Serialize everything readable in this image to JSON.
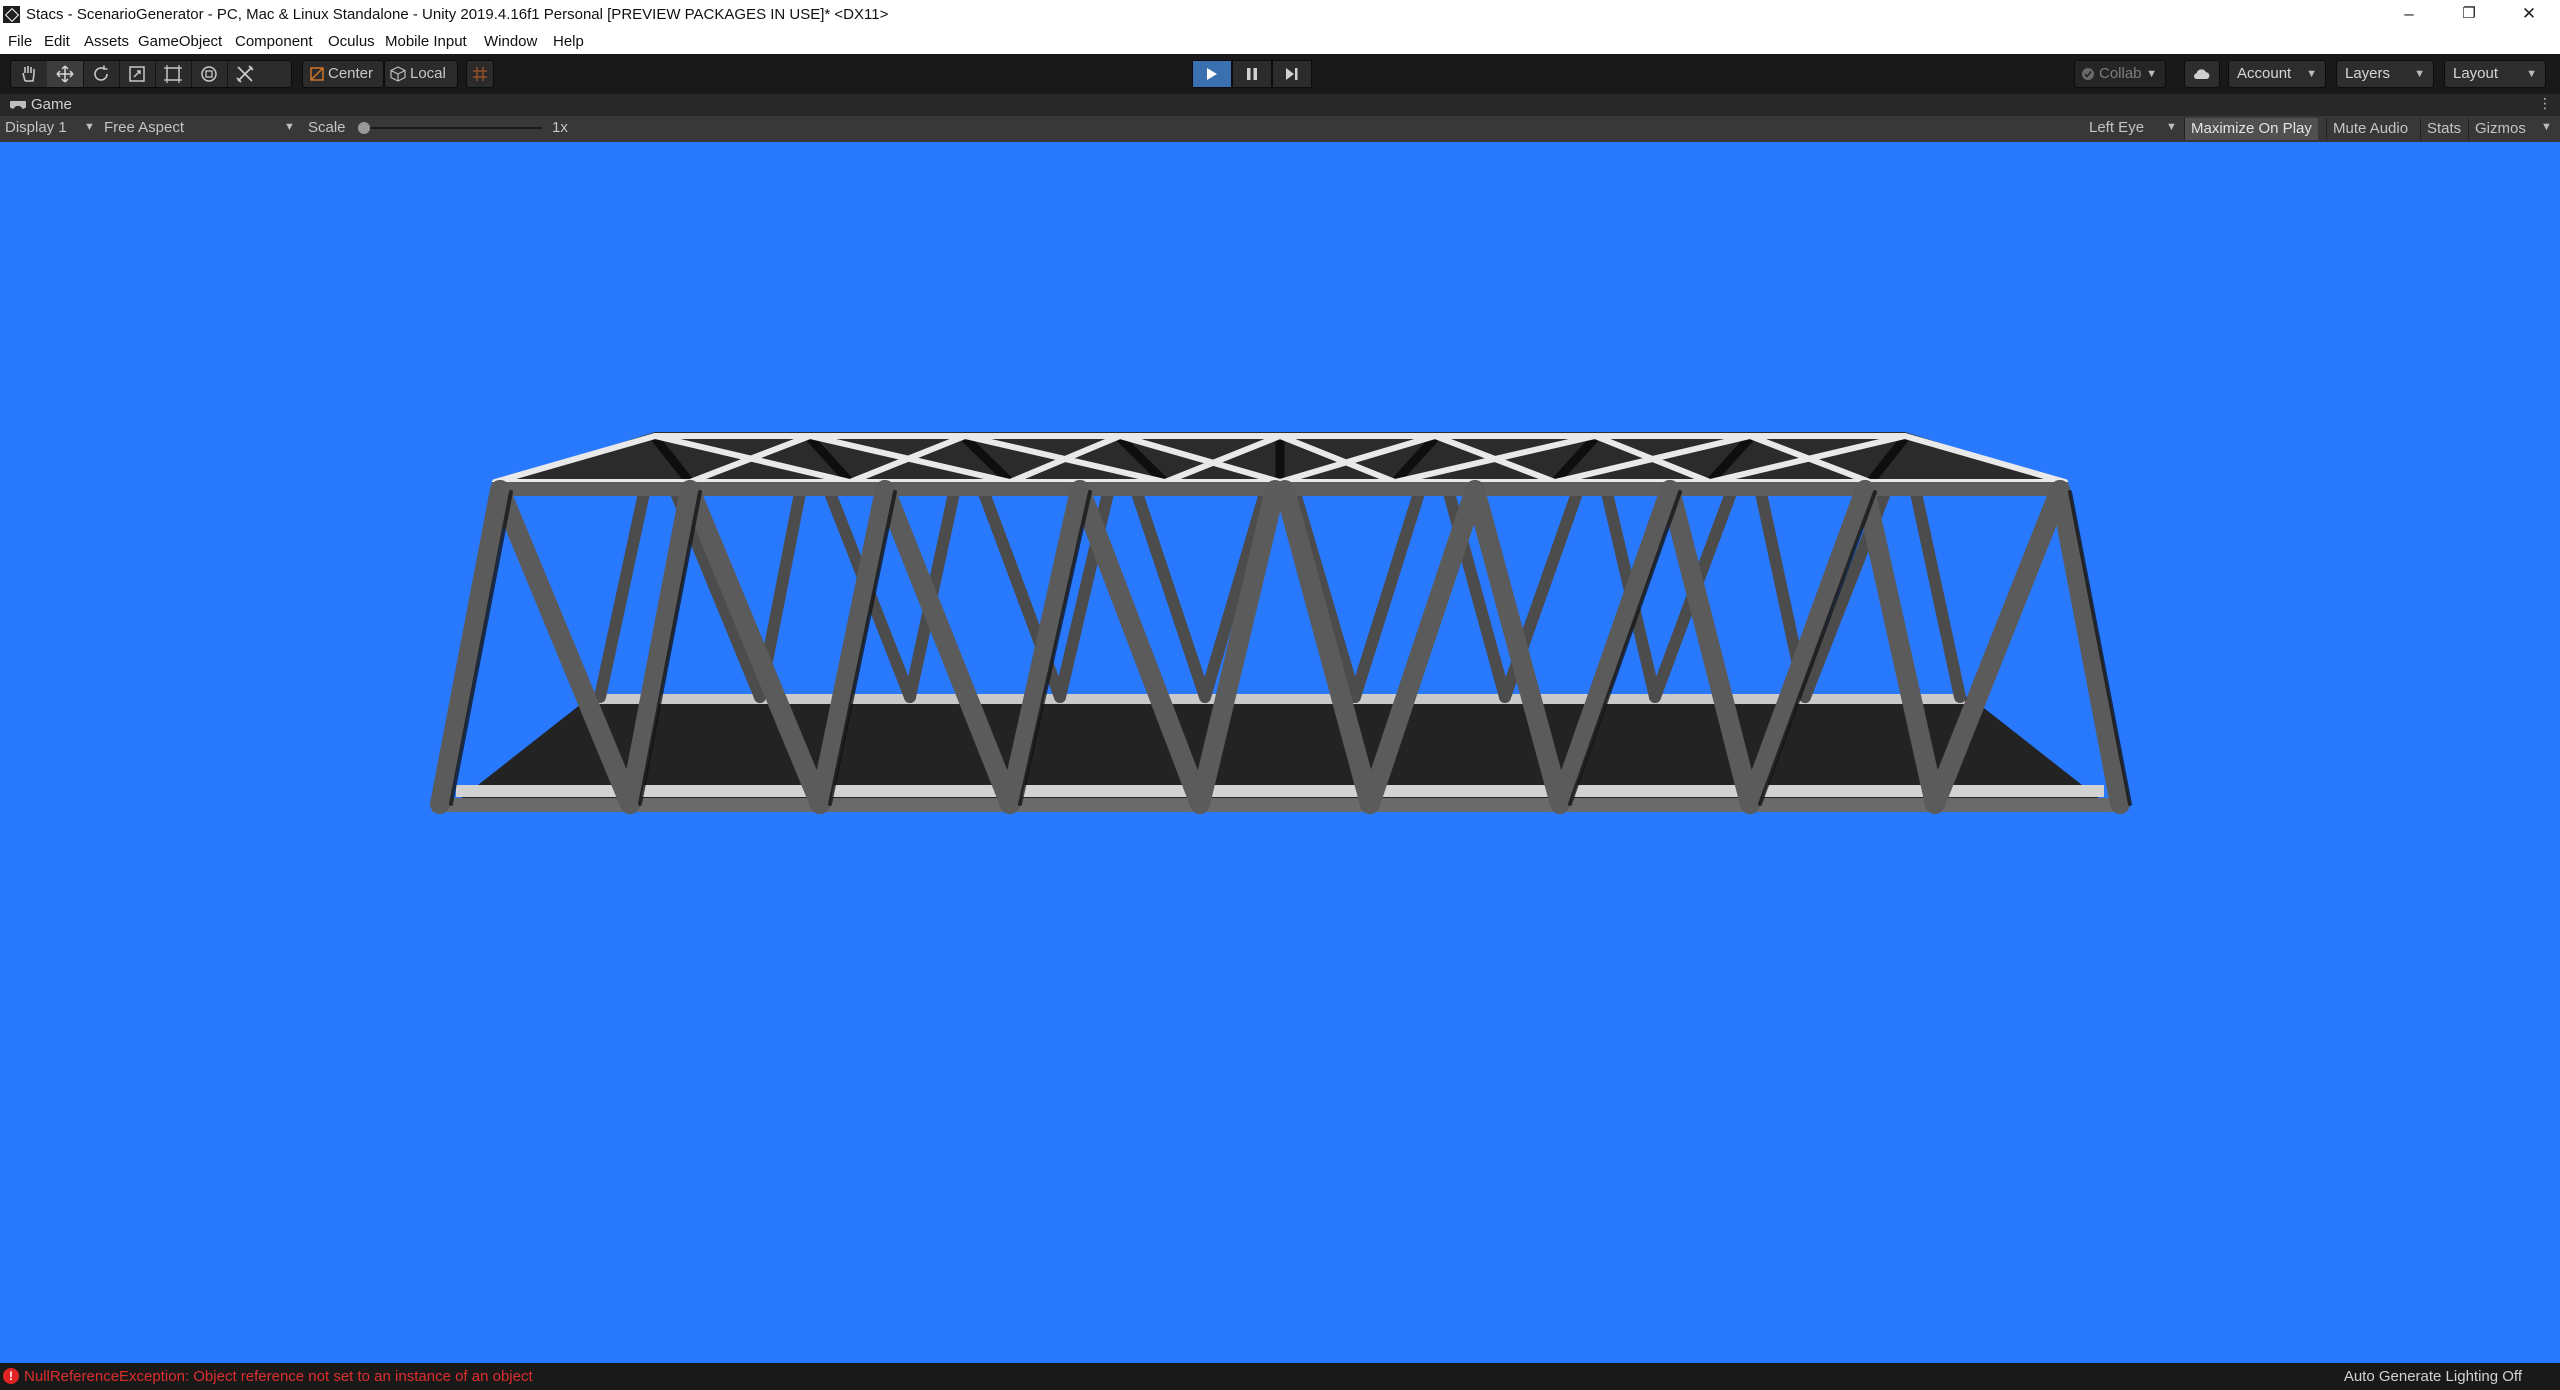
{
  "window": {
    "title": "Stacs - ScenarioGenerator - PC, Mac & Linux Standalone - Unity 2019.4.16f1 Personal [PREVIEW PACKAGES IN USE]* <DX11>",
    "minimize": "–",
    "maximize": "❐",
    "close": "✕"
  },
  "menu": [
    "File",
    "Edit",
    "Assets",
    "GameObject",
    "Component",
    "Oculus",
    "Mobile Input",
    "Window",
    "Help"
  ],
  "toolbar": {
    "pivot_label": "Center",
    "rotation_label": "Local",
    "collab_label": "Collab",
    "account_label": "Account",
    "layers_label": "Layers",
    "layout_label": "Layout",
    "play_state": "playing"
  },
  "game_view": {
    "tab_label": "Game",
    "display": "Display 1",
    "aspect": "Free Aspect",
    "scale_label": "Scale",
    "scale_value": "1x",
    "eye": "Left Eye",
    "maximize_on_play": "Maximize On Play",
    "mute_audio": "Mute Audio",
    "stats": "Stats",
    "gizmos": "Gizmos",
    "background_color": "#2979ff"
  },
  "status": {
    "error_message": "NullReferenceException: Object reference not set to an instance of an object",
    "right_text": "Auto Generate Lighting Off"
  },
  "colors": {
    "error": "#dd2e2e",
    "play_active": "#3a6fb0",
    "truss_steel": "#5b5b5b",
    "truss_highlight": "#eeeeee",
    "deck": "#222222"
  }
}
